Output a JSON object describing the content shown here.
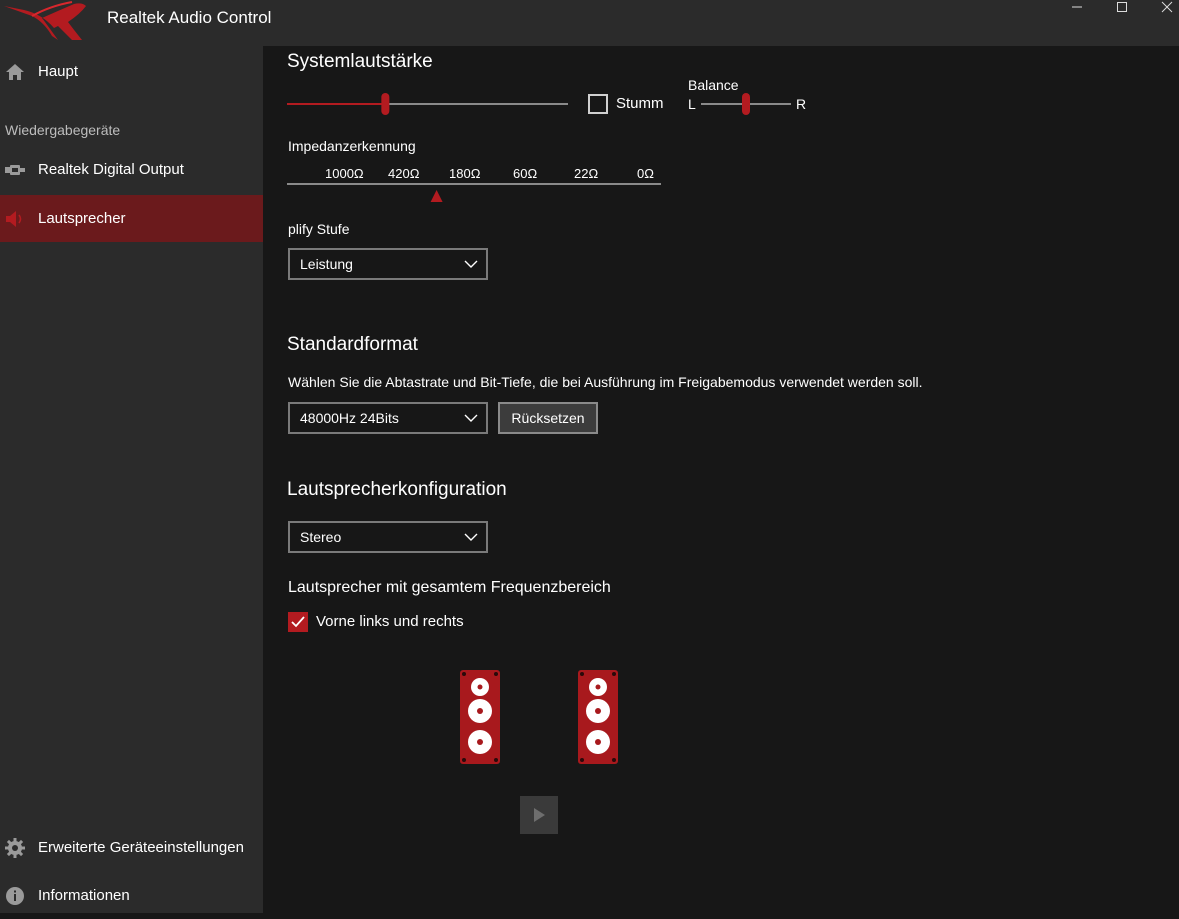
{
  "window": {
    "title": "Realtek Audio Control",
    "controls": [
      "minimize-icon",
      "maximize-icon",
      "close-icon"
    ]
  },
  "sidebar": {
    "section_label": "Wiedergabegeräte",
    "items": [
      {
        "label": "Haupt",
        "icon": "home-icon"
      },
      {
        "label": "Realtek Digital Output",
        "icon": "digital-output-icon"
      },
      {
        "label": "Lautsprecher",
        "icon": "speaker-icon",
        "active": true
      }
    ],
    "bottom_items": [
      {
        "label": "Erweiterte Geräteeinstellungen",
        "icon": "gear-icon"
      },
      {
        "label": "Informationen",
        "icon": "info-icon"
      }
    ]
  },
  "volume": {
    "title": "Systemlautstärke",
    "level": 0.35,
    "mute_label": "Stumm",
    "muted": false,
    "balance_label": "Balance",
    "balance_left": "L",
    "balance_right": "R",
    "balance_position": 0.5
  },
  "impedance": {
    "title": "Impedanzerkennung",
    "ticks": [
      "1000Ω",
      "420Ω",
      "180Ω",
      "60Ω",
      "22Ω",
      "0Ω"
    ],
    "marker_position": 0.4
  },
  "amplify": {
    "label": "plify Stufe",
    "selected": "Leistung"
  },
  "format": {
    "title": "Standardformat",
    "description": "Wählen Sie die Abtastrate und Bit-Tiefe, die bei Ausführung im Freigabemodus verwendet werden soll.",
    "selected": "48000Hz 24Bits",
    "reset_label": "Rücksetzen"
  },
  "speaker_config": {
    "title": "Lautsprecherkonfiguration",
    "selected": "Stereo",
    "fullrange_title": "Lautsprecher mit gesamtem Frequenzbereich",
    "front_label": "Vorne links und rechts",
    "front_checked": true
  },
  "colors": {
    "accent": "#b31b20",
    "active_nav": "#6b1a1c",
    "sidebar_bg": "#2b2b2b",
    "main_bg": "#171717"
  }
}
